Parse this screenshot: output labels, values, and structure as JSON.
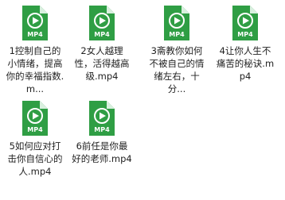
{
  "colors": {
    "icon_green": "#2f9e44",
    "icon_page": "#ffffff",
    "icon_fold": "#d9f0df",
    "icon_text": "#ffffff",
    "text": "#222222",
    "background": "#ffffff"
  },
  "files": [
    {
      "name": "1控制自己的小情绪，提高你的幸福指数.m...",
      "type_label": "MP4",
      "icon": "mp4-video-file-icon"
    },
    {
      "name": "2女人越理性，活得越高级.mp4",
      "type_label": "MP4",
      "icon": "mp4-video-file-icon"
    },
    {
      "name": "3斋教你如何不被自己的情绪左右，十分...",
      "type_label": "MP4",
      "icon": "mp4-video-file-icon"
    },
    {
      "name": "4让你人生不痛苦的秘诀.mp4",
      "type_label": "MP4",
      "icon": "mp4-video-file-icon"
    },
    {
      "name": "5如何应对打击你自信心的人.mp4",
      "type_label": "MP4",
      "icon": "mp4-video-file-icon"
    },
    {
      "name": "6前任是你最好的老师.mp4",
      "type_label": "MP4",
      "icon": "mp4-video-file-icon"
    }
  ]
}
